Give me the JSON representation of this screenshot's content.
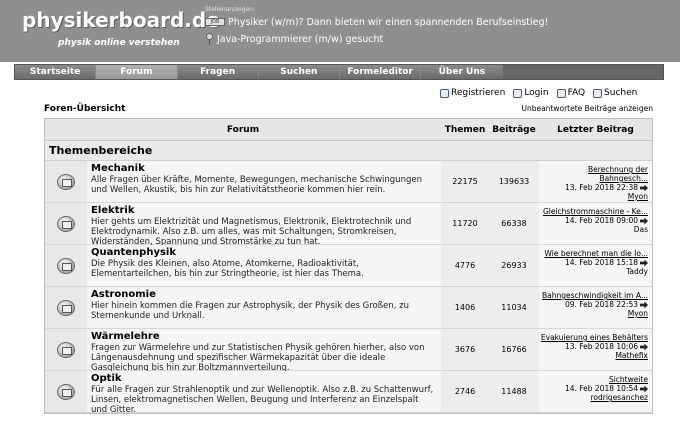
{
  "header": {
    "logo": "physikerboard.de",
    "logo_sub": "physik online verstehen",
    "ads_label": "Stellenanzeigen:",
    "ads": [
      {
        "text": "Physiker (w/m)? Dann bieten wir einen spannenden Berufseinstieg!"
      },
      {
        "text": "Java-Programmierer (m/w) gesucht"
      }
    ]
  },
  "nav": [
    "Startseite",
    "Forum",
    "Fragen",
    "Suchen",
    "Formeleditor",
    "Über Uns"
  ],
  "toolbar": {
    "register": "Registrieren",
    "login": "Login",
    "faq": "FAQ",
    "search": "Suchen"
  },
  "breadcrumb": "Foren-Übersicht",
  "unanswered": "Unbeantwortete Beiträge anzeigen",
  "table": {
    "headers": {
      "forum": "Forum",
      "themen": "Themen",
      "beitraege": "Beiträge",
      "letzter": "Letzter Beitrag"
    },
    "category": "Themenbereiche",
    "rows": [
      {
        "title": "Mechanik",
        "desc": "Alle Fragen über Kräfte, Momente, Bewegungen, mechanische Schwingungen und Wellen, Akustik, bis hin zur Relativitätstheorie kommen hier rein.",
        "themen": "22175",
        "beitraege": "139633",
        "last_topic": "Berechnung der Bahngesch...",
        "last_date": "13. Feb 2018 22:38",
        "last_user": "Myon"
      },
      {
        "title": "Elektrik",
        "desc": "Hier gehts um Elektrizität und Magnetismus, Elektronik, Elektrotechnik und Elektrodynamik. Also z.B. um alles, was mit Schaltungen, Stromkreisen, Widerständen, Spannung und Stromstärke zu tun hat.",
        "themen": "11720",
        "beitraege": "66338",
        "last_topic": "Gleichstrommaschine - Ke...",
        "last_date": "14. Feb 2018 09:00",
        "last_user": "Das"
      },
      {
        "title": "Quantenphysik",
        "desc": "Die Physik des Kleinen, also Atome, Atomkerne, Radioaktivität, Elementarteilchen, bis hin zur Stringtheorie, ist hier das Thema.",
        "themen": "4776",
        "beitraege": "26933",
        "last_topic": "Wie berechnet man die Io...",
        "last_date": "14. Feb 2018 15:18",
        "last_user": "Taddy"
      },
      {
        "title": "Astronomie",
        "desc": "Hier hinein kommen die Fragen zur Astrophysik, der Physik des Großen, zu Sternenkunde und Urknall.",
        "themen": "1406",
        "beitraege": "11034",
        "last_topic": "Bahngeschwindigkeit im A...",
        "last_date": "09. Feb 2018 22:53",
        "last_user": "Myon"
      },
      {
        "title": "Wärmelehre",
        "desc": "Fragen zur Wärmelehre und zur Statistischen Physik gehören hierher, also von Längenausdehnung und spezifischer Wärmekapazität über die ideale Gasgleichung bis hin zur Boltzmannverteilung.",
        "themen": "3676",
        "beitraege": "16766",
        "last_topic": "Evakuierung eines Behälters",
        "last_date": "13. Feb 2018 10:06",
        "last_user": "Mathefix"
      },
      {
        "title": "Optik",
        "desc": "Für alle Fragen zur Strahlenoptik und zur Wellenoptik. Also z.B. zu Schattenwurf, Linsen, elektromagnetischen Wellen, Beugung und Interferenz an Einzelspalt und Gitter.",
        "themen": "2746",
        "beitraege": "11488",
        "last_topic": "Sichtweite",
        "last_date": "14. Feb 2018 10:54",
        "last_user": "rodrigesanchez"
      }
    ]
  }
}
